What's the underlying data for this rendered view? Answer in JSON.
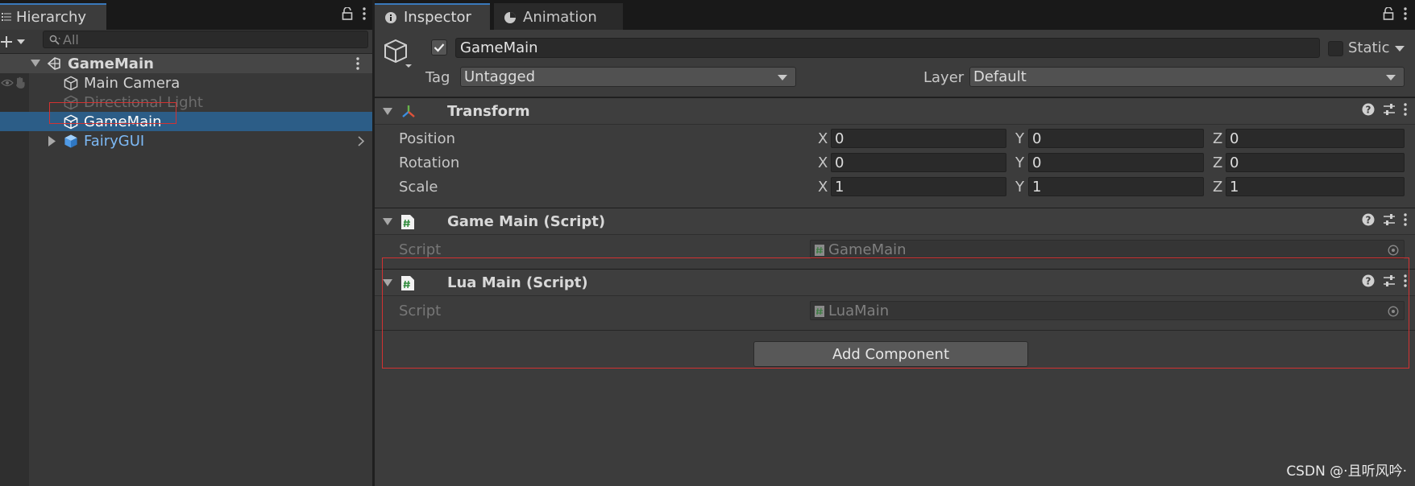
{
  "hierarchy": {
    "tab_label": "Hierarchy",
    "search_placeholder": "All",
    "scene_name": "GameMain",
    "items": [
      {
        "label": "Main Camera",
        "state": "normal"
      },
      {
        "label": "Directional Light",
        "state": "disabled"
      },
      {
        "label": "GameMain",
        "state": "selected"
      },
      {
        "label": "FairyGUI",
        "state": "prefab"
      }
    ]
  },
  "inspector": {
    "tabs": [
      "Inspector",
      "Animation"
    ],
    "object_name": "GameMain",
    "active_checked": true,
    "static_label": "Static",
    "tag_label": "Tag",
    "tag_value": "Untagged",
    "layer_label": "Layer",
    "layer_value": "Default",
    "transform": {
      "title": "Transform",
      "position_label": "Position",
      "rotation_label": "Rotation",
      "scale_label": "Scale",
      "axis_x": "X",
      "axis_y": "Y",
      "axis_z": "Z",
      "position": [
        "0",
        "0",
        "0"
      ],
      "rotation": [
        "0",
        "0",
        "0"
      ],
      "scale": [
        "1",
        "1",
        "1"
      ]
    },
    "game_main_script": {
      "title": "Game Main (Script)",
      "script_label": "Script",
      "script_value": "GameMain"
    },
    "lua_main_script": {
      "title": "Lua Main (Script)",
      "script_label": "Script",
      "script_value": "LuaMain"
    },
    "add_component_label": "Add Component"
  },
  "watermark": "CSDN @·且听风吟·",
  "colors": {
    "selection": "#2c5d87",
    "tab_accent": "#3a79bb",
    "highlight_box": "#d23232",
    "prefab_blue": "#7db9f5"
  }
}
